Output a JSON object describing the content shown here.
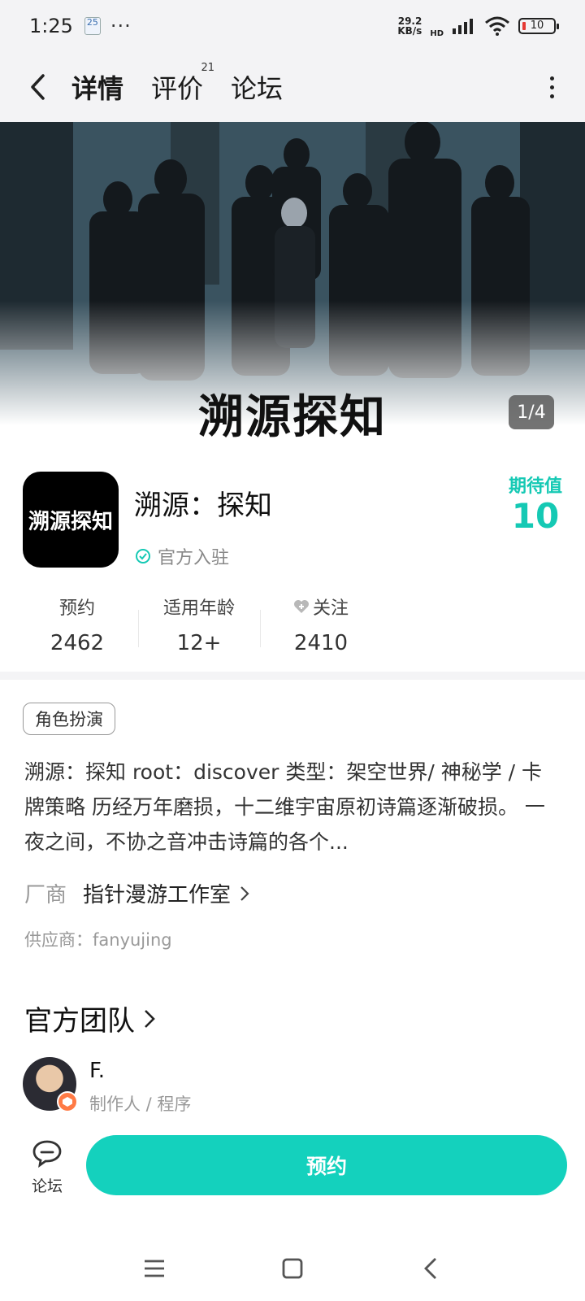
{
  "status_bar": {
    "time": "1:25",
    "badge": "25",
    "dots": "···",
    "net_speed_value": "29.2",
    "net_speed_unit": "KB/s",
    "hd_label": "HD",
    "battery": "10"
  },
  "nav": {
    "tabs": [
      {
        "label": "详情",
        "active": true
      },
      {
        "label": "评价",
        "count": "21"
      },
      {
        "label": "论坛"
      }
    ]
  },
  "banner": {
    "logo_text": "溯源探知",
    "page_indicator": "1/4"
  },
  "game": {
    "icon_text": "溯源探知",
    "title": "溯源：探知",
    "official_label": "官方入驻",
    "expect_label": "期待值",
    "expect_value": "10"
  },
  "stats": [
    {
      "label": "预约",
      "value": "2462"
    },
    {
      "label": "适用年龄",
      "value": "12+"
    },
    {
      "label": "关注",
      "value": "2410"
    }
  ],
  "tags": [
    "角色扮演"
  ],
  "description": "溯源：探知 root：discover 类型：架空世界/ 神秘学 / 卡牌策略 历经万年磨损，十二维宇宙原初诗篇逐渐破损。 一夜之间，不协之音冲击诗篇的各个...",
  "vendor": {
    "label": "厂商",
    "name": "指针漫游工作室"
  },
  "supplier": "供应商：fanyujing",
  "team": {
    "title": "官方团队",
    "members": [
      {
        "name": "F.",
        "role": "制作人 / 程序"
      }
    ]
  },
  "bottom_bar": {
    "forum_label": "论坛",
    "reserve_label": "预约"
  },
  "colors": {
    "accent": "#14d1bd"
  }
}
